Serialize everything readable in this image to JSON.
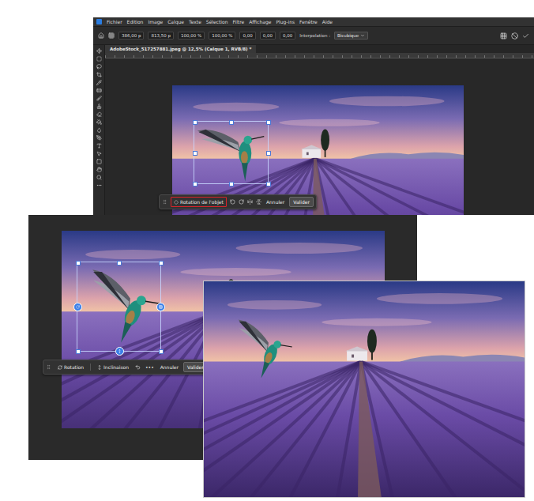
{
  "editor": {
    "menu": [
      "Fichier",
      "Edition",
      "Image",
      "Calque",
      "Texte",
      "Sélection",
      "Filtre",
      "Affichage",
      "Plug-ins",
      "Fenêtre",
      "Aide"
    ],
    "options": [
      "386,00 p",
      "813,50 p",
      "100,00 %",
      "100,00 %",
      "0,00",
      "0,00",
      "0,00"
    ],
    "interpolation_label": "Interpolation :",
    "interpolation_value": "Bicubique",
    "document_tab": "AdobeStock_517257881.jpeg @ 12,5% (Calque 1, RVB/8) *",
    "context_bar": {
      "items": [
        {
          "label": "Rotation de l'objet",
          "highlighted": true
        }
      ],
      "cancel": "Annuler",
      "confirm": "Valider"
    }
  },
  "transform_view": {
    "context_bar": {
      "items": [
        {
          "label": "Rotation",
          "highlighted": false
        },
        {
          "label": "Inclinaison",
          "highlighted": false
        }
      ],
      "more": "•••",
      "cancel": "Annuler",
      "confirm": "Valider"
    }
  }
}
